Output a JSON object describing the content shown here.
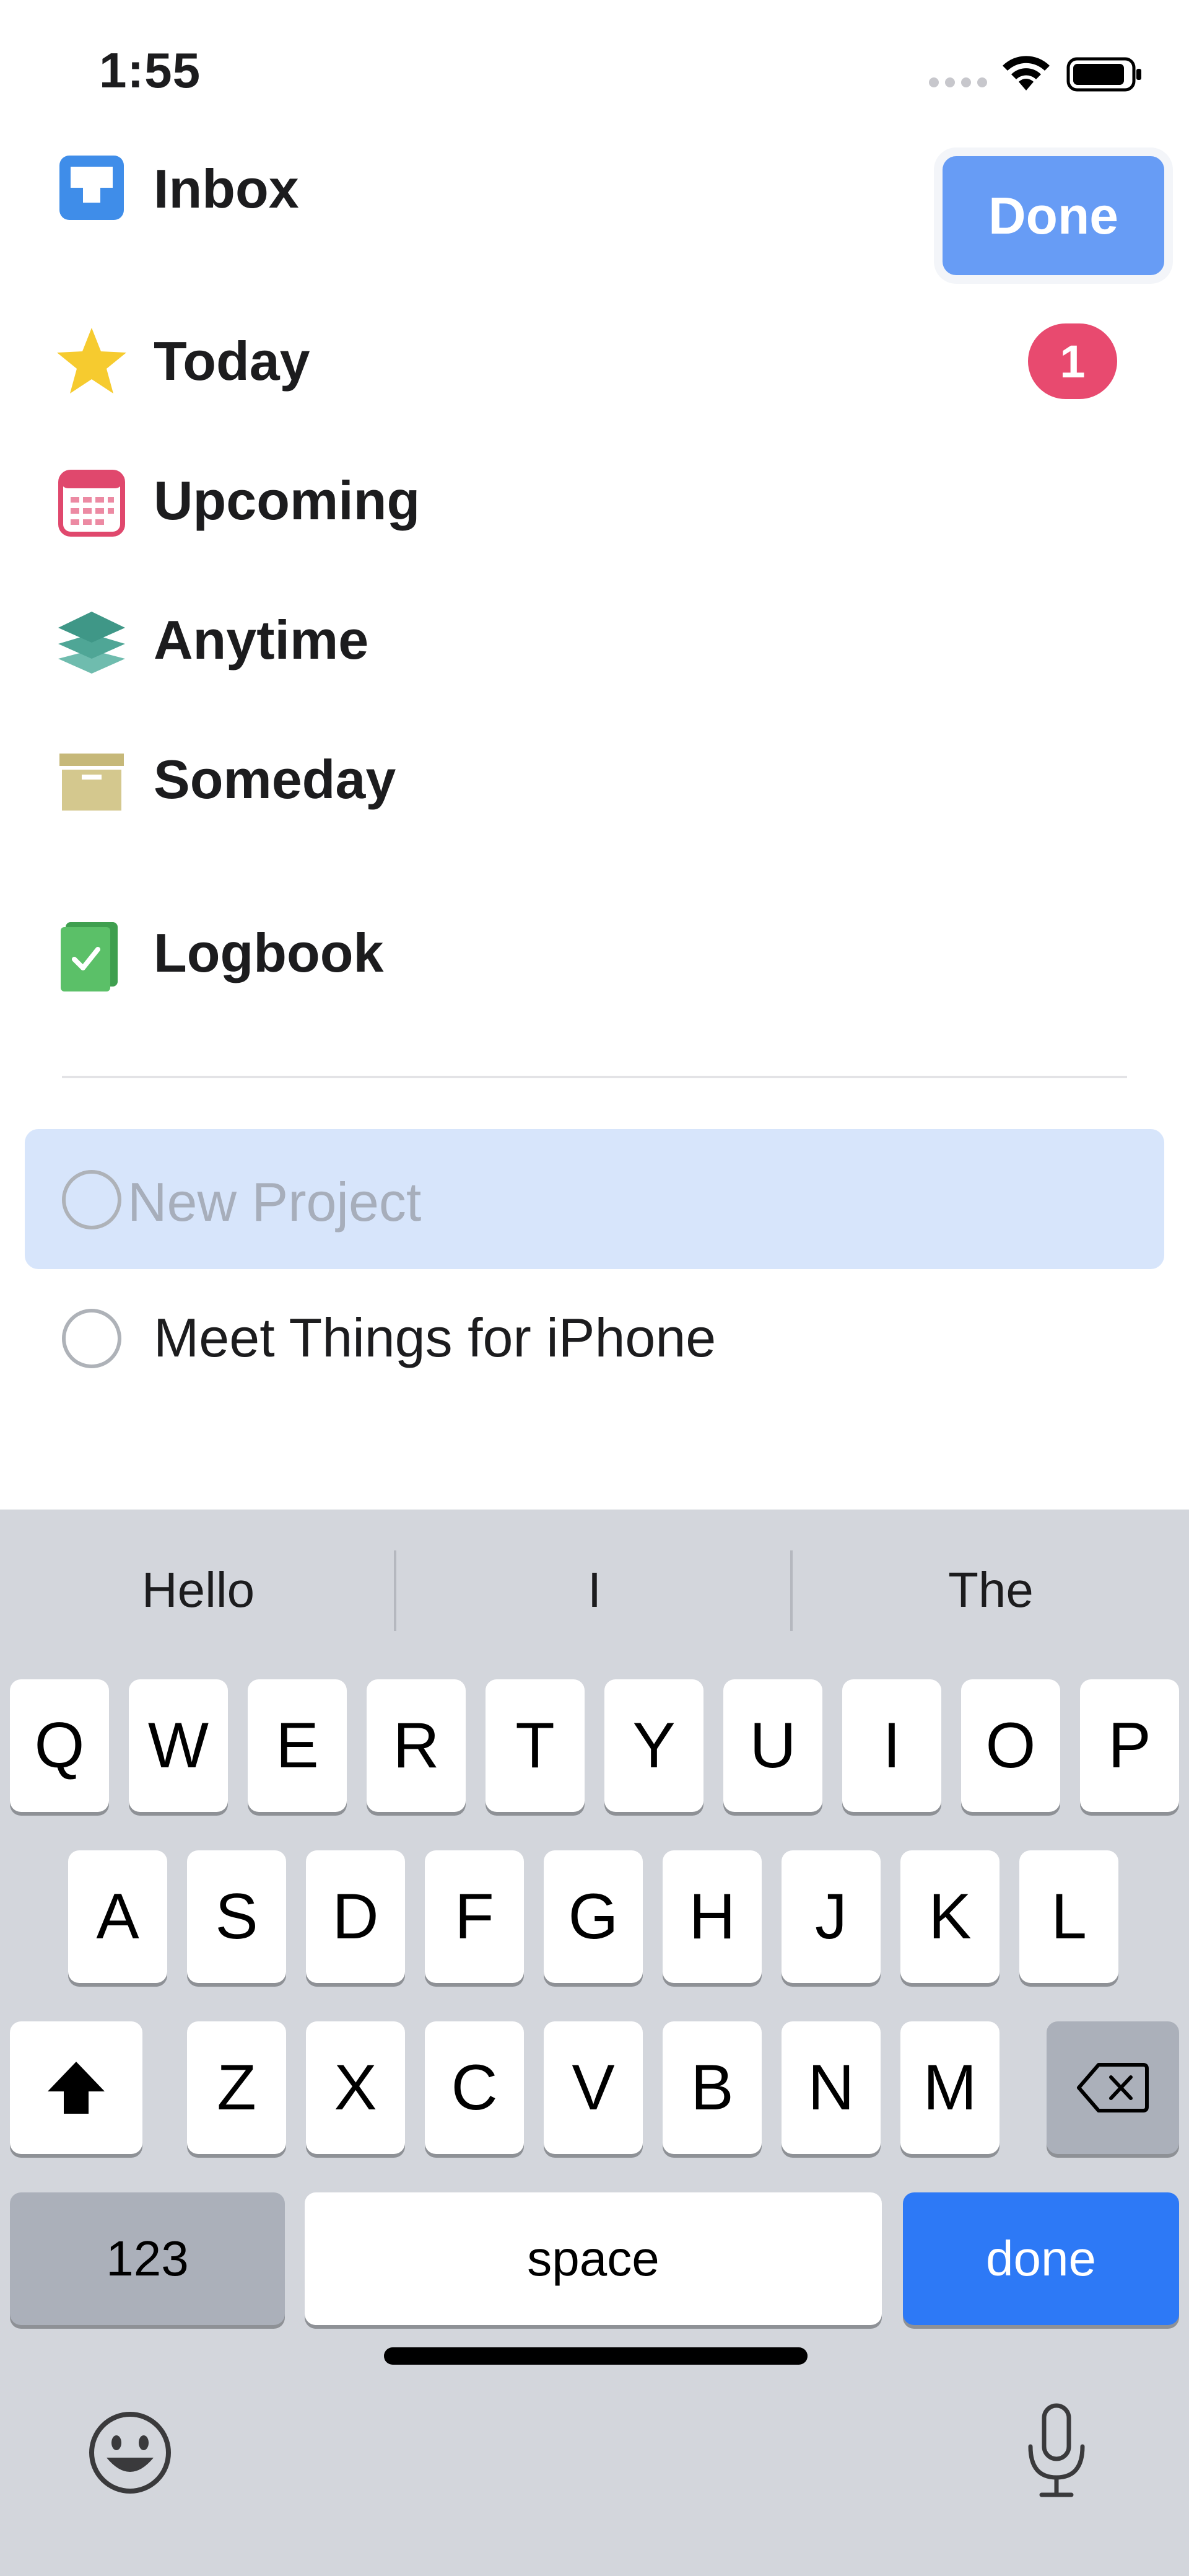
{
  "status_bar": {
    "time": "1:55"
  },
  "toolbar": {
    "done_label": "Done"
  },
  "nav": {
    "inbox": "Inbox",
    "today": "Today",
    "today_badge": "1",
    "upcoming": "Upcoming",
    "anytime": "Anytime",
    "someday": "Someday",
    "logbook": "Logbook"
  },
  "projects": {
    "new_placeholder": "New Project",
    "new_value": "",
    "items": [
      "Meet Things for iPhone"
    ]
  },
  "keyboard": {
    "suggestions": [
      "Hello",
      "I",
      "The"
    ],
    "row1": [
      "Q",
      "W",
      "E",
      "R",
      "T",
      "Y",
      "U",
      "I",
      "O",
      "P"
    ],
    "row2": [
      "A",
      "S",
      "D",
      "F",
      "G",
      "H",
      "J",
      "K",
      "L"
    ],
    "row3": [
      "Z",
      "X",
      "C",
      "V",
      "B",
      "N",
      "M"
    ],
    "numbers_label": "123",
    "space_label": "space",
    "done_label": "done"
  },
  "colors": {
    "accent": "#2d79f6",
    "done_pill": "#679cf5",
    "badge": "#e84a6f",
    "editing_row": "#d7e5fb"
  }
}
